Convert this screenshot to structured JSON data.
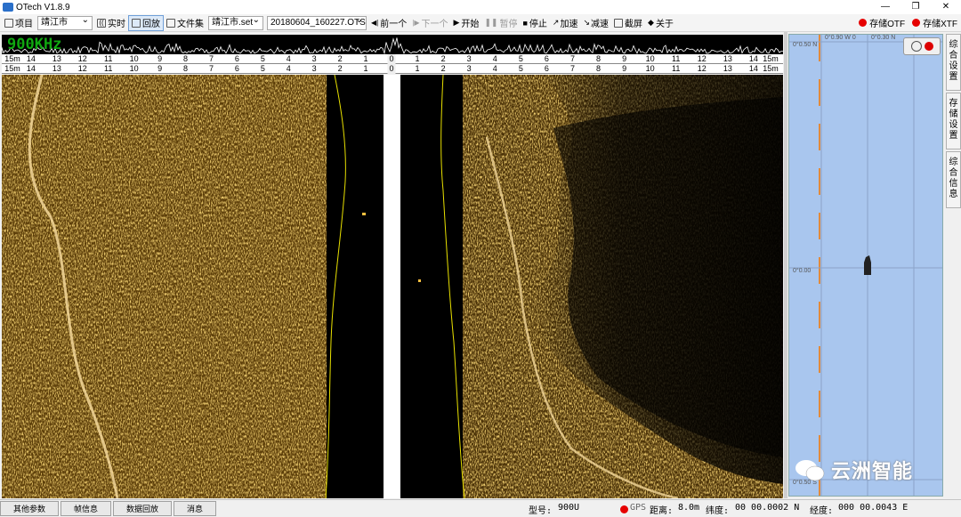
{
  "window": {
    "title": "OTech V1.8.9",
    "minimize": "—",
    "restore": "❐",
    "close": "✕"
  },
  "toolbar": {
    "project_label": "项目",
    "project_value": "靖江市",
    "realtime_label": "实时",
    "playback_label": "回放",
    "fileset_label": "文件集",
    "fileset_value": "靖江市.set",
    "file_value": "20180604_160227.OTSS",
    "prev_label": "前一个",
    "next_label": "下一个",
    "start_label": "开始",
    "pause_label": "暂停",
    "stop_label": "停止",
    "speedup_label": "加速",
    "slowdown_label": "减速",
    "screenshot_label": "截屏",
    "about_label": "关于",
    "save_otf_label": "存储OTF",
    "save_xtf_label": "存储XTF"
  },
  "waveform": {
    "frequency": "900KHz"
  },
  "scale": {
    "left_labels": [
      "15m",
      "14",
      "13",
      "12",
      "11",
      "10",
      "9",
      "8",
      "7",
      "6",
      "5",
      "4",
      "3",
      "2",
      "1"
    ],
    "center": "0",
    "right_labels": [
      "1",
      "2",
      "3",
      "4",
      "5",
      "6",
      "7",
      "8",
      "9",
      "10",
      "11",
      "12",
      "13",
      "14",
      "15m"
    ]
  },
  "map": {
    "coord_top1": "0°0.50 N",
    "coord_top2": "0°0.90 W 0",
    "coord_top3": "0°0.30 N",
    "coord_mid": "0°0.00",
    "coord_bottom": "0°0.50 S"
  },
  "side_tabs": [
    {
      "label": "综合设置"
    },
    {
      "label": "存储设置"
    },
    {
      "label": "综合信息"
    }
  ],
  "status": {
    "tabs": [
      "其他参数",
      "帧信息",
      "数据回放",
      "消息"
    ],
    "model_label": "型号:",
    "model_value": "900U",
    "gps_label": "GPS",
    "distance_label": "距离:",
    "distance_value": "8.0m",
    "latitude_label": "纬度:",
    "latitude_value": "00 00.0002 N",
    "longitude_label": "经度:",
    "longitude_value": "000 00.0043 E"
  },
  "watermark": {
    "text": "云洲智能"
  },
  "colors": {
    "sonar": "#c8901e",
    "record_dot": "#e60000",
    "frequency_text": "#10a810",
    "map_bg": "#a9c6ee"
  }
}
